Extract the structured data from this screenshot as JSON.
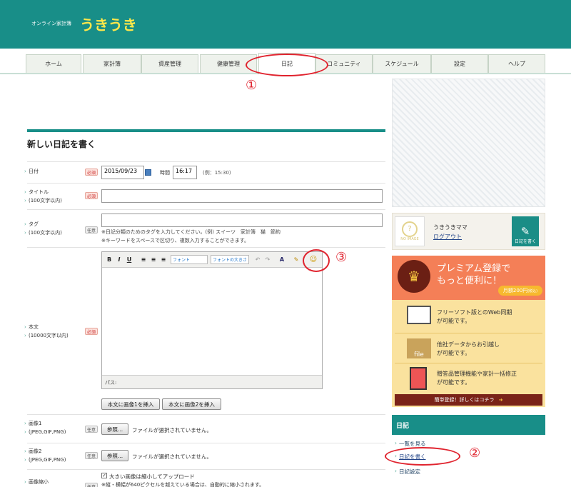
{
  "header": {
    "subtitle": "オンライン家計簿",
    "brand": "うきうき"
  },
  "nav": {
    "tabs": [
      "ホーム",
      "家計簿",
      "資産管理",
      "健康管理",
      "日記",
      "コミュニティ",
      "スケジュール",
      "設定",
      "ヘルプ"
    ],
    "active": "日記"
  },
  "section": {
    "title": "新しい日記を書く"
  },
  "form": {
    "date": {
      "label": "日付",
      "badge": "必須",
      "value": "2015/09/23",
      "time_label": "時間",
      "time_value": "16:17",
      "time_example": "(例：15:30)"
    },
    "title": {
      "label": "タイトル",
      "sub": "(100文字以内)",
      "badge": "必須",
      "value": ""
    },
    "tag": {
      "label": "タグ",
      "sub": "(100文字以内)",
      "badge": "任意",
      "value": "",
      "note1": "※日記分類のためのタグを入力してください。(例) スイーツ　家計簿　猫　節約",
      "note2": "※キーワードをスペースで区切り、複数入力することができます。"
    },
    "body": {
      "label": "本文",
      "sub": "(10000文字以内)",
      "badge": "必須",
      "font_select": "フォント",
      "size_select": "フォントの大きさ",
      "status": "パス:",
      "insert1": "本文に画像1を挿入",
      "insert2": "本文に画像2を挿入"
    },
    "image1": {
      "label": "画像1",
      "sub": "(JPEG,GIF,PNG)",
      "badge": "任意",
      "button": "参照...",
      "status": "ファイルが選択されていません。"
    },
    "image2": {
      "label": "画像2",
      "sub": "(JPEG,GIF,PNG)",
      "badge": "任意",
      "button": "参照...",
      "status": "ファイルが選択されていません。"
    },
    "shrink": {
      "label": "画像縮小",
      "badge": "任意",
      "check_label": "大きい画像は縮小してアップロード",
      "note": "※縦・横幅が640ピクセルを越えている場合は、自動的に縮小されます。"
    }
  },
  "sidebar": {
    "user": {
      "name": "うきうきママ",
      "logout": "ログアウト",
      "avatar_text": "NO IMAGE",
      "write_button": "日記を書く"
    },
    "premium": {
      "title1": "プレミアム登録で",
      "title2": "もっと便利に！",
      "price": "月額200円",
      "price_note": "(税込)",
      "features": [
        {
          "l1": "フリーソフト版とのWeb同期",
          "l2": "が可能です。",
          "icon": "file"
        },
        {
          "l1": "他社データからお引越し",
          "l2": "が可能です。",
          "icon": "file"
        },
        {
          "l1": "贈答品管理機能や家計一括修正",
          "l2": "が可能です。",
          "icon": "calc"
        }
      ],
      "cta": "簡単登録！詳しくはコチラ"
    },
    "diary": {
      "title": "日記",
      "links": [
        "一覧を見る",
        "日記を書く",
        "日記設定"
      ]
    }
  },
  "annotations": [
    "①",
    "②",
    "③"
  ],
  "colors": {
    "teal": "#188e88",
    "brand_yellow": "#ffe84a",
    "annotation_red": "#e0232e"
  }
}
